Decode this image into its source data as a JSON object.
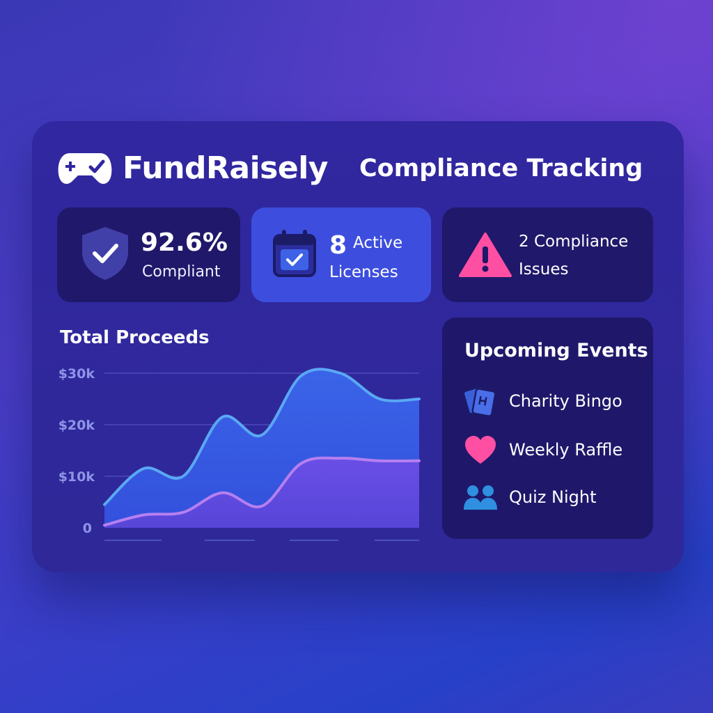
{
  "header": {
    "brand": "FundRaisely",
    "title": "Compliance Tracking"
  },
  "stats": {
    "compliance": {
      "value": "92.6%",
      "label": "Compliant"
    },
    "licenses": {
      "count": "8",
      "word": "Active",
      "label": "Licenses"
    },
    "issues": {
      "line1": "2 Compliance",
      "line2": "Issues"
    }
  },
  "chart_title": "Total Proceeds",
  "chart_data": {
    "type": "area",
    "title": "Total Proceeds",
    "xlabel": "",
    "ylabel": "",
    "ylim": [
      0,
      30000
    ],
    "y_ticks": [
      "0",
      "$10k",
      "$20k",
      "$30k"
    ],
    "x_ticks": [
      "",
      "",
      "",
      ""
    ],
    "grid": true,
    "x": [
      0,
      1,
      2,
      3,
      4,
      5,
      6,
      7,
      8
    ],
    "series": [
      {
        "values": [
          4500,
          11500,
          10000,
          21500,
          18000,
          29500,
          30000,
          25000,
          25000
        ]
      },
      {
        "values": [
          500,
          2500,
          3000,
          6800,
          4200,
          12500,
          13500,
          13000,
          13000
        ]
      }
    ]
  },
  "events": {
    "title": "Upcoming Events",
    "items": [
      {
        "label": "Charity Bingo",
        "icon": "bingo-cards-icon"
      },
      {
        "label": "Weekly Raffle",
        "icon": "heart-icon"
      },
      {
        "label": "Quiz Night",
        "icon": "people-icon"
      }
    ]
  },
  "colors": {
    "accent_pink": "#ff4fa3",
    "accent_blue": "#3d4ede",
    "line_top": "#5aa8f4",
    "line_bottom": "#b57ff0"
  }
}
